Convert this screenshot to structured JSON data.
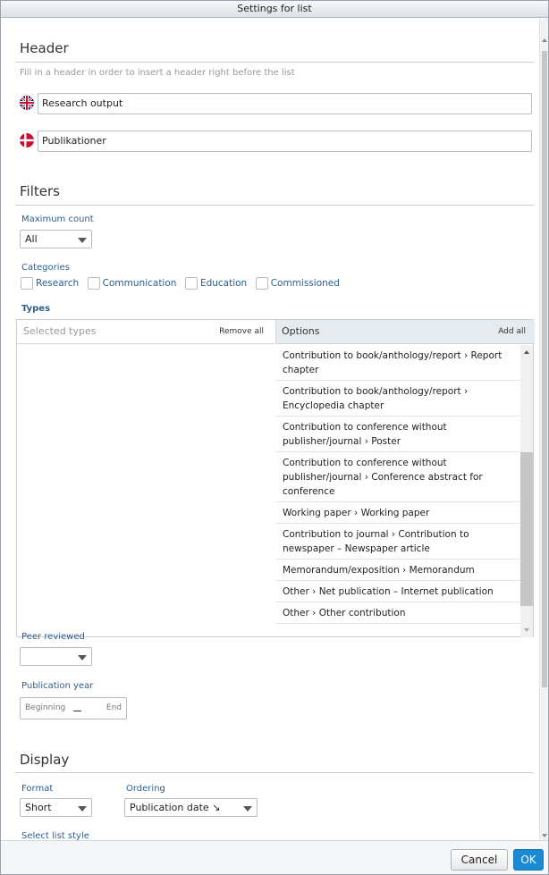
{
  "dialog": {
    "title": "Settings for list"
  },
  "header_section": {
    "title": "Header",
    "hint": "Fill in a header in order to insert a header right before the list",
    "english_value": "Research output",
    "danish_value": "Publikationer"
  },
  "filters": {
    "title": "Filters",
    "max_count_label": "Maximum count",
    "max_count_value": "All",
    "categories_label": "Categories",
    "categories": [
      {
        "label": "Research",
        "checked": false
      },
      {
        "label": "Communication",
        "checked": false
      },
      {
        "label": "Education",
        "checked": false
      },
      {
        "label": "Commissioned",
        "checked": false
      }
    ],
    "types_label": "Types",
    "selected_types_placeholder": "Selected types",
    "remove_all_label": "Remove all",
    "options_label": "Options",
    "add_all_label": "Add all",
    "options": [
      "Contribution to book/anthology/report › Report chapter",
      "Contribution to book/anthology/report › Encyclopedia chapter",
      "Contribution to conference without publisher/journal › Poster",
      "Contribution to conference without publisher/journal › Conference abstract for conference",
      "Working paper › Working paper",
      "Contribution to journal › Contribution to newspaper – Newspaper article",
      "Memorandum/exposition › Memorandum",
      "Other › Net publication – Internet publication",
      "Other › Other contribution"
    ],
    "peer_reviewed_label": "Peer reviewed",
    "peer_reviewed_value": "",
    "publication_year_label": "Publication year",
    "year_beginning": "Beginning",
    "year_end": "End"
  },
  "display": {
    "title": "Display",
    "format_label": "Format",
    "format_value": "Short",
    "ordering_label": "Ordering",
    "ordering_value": "Publication date ↘",
    "list_style_label": "Select list style"
  },
  "footer": {
    "cancel_label": "Cancel",
    "ok_label": "OK"
  },
  "colors": {
    "accent_label": "#2c5e8f",
    "ok_button": "#1a8ad4"
  }
}
